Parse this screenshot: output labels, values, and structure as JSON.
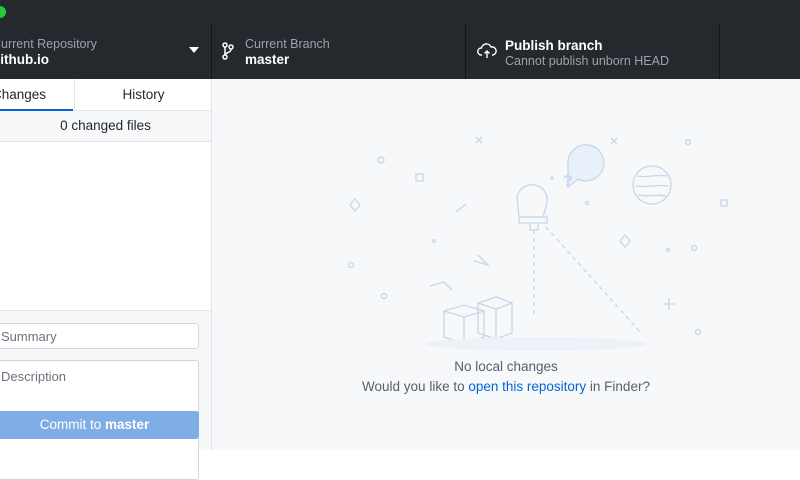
{
  "toolbar": {
    "repository": {
      "label": "Current Repository",
      "value": "github.io"
    },
    "branch": {
      "label": "Current Branch",
      "value": "master"
    },
    "publish": {
      "label": "Publish branch",
      "detail": "Cannot publish unborn HEAD"
    }
  },
  "sidebar": {
    "tabs": [
      {
        "label": "Changes"
      },
      {
        "label": "History"
      }
    ],
    "changed_files": "0 changed files",
    "summary_placeholder": "Summary",
    "description_placeholder": "Description",
    "commit_button": {
      "prefix": "Commit to ",
      "branch": "master"
    }
  },
  "main": {
    "empty_title": "No local changes",
    "empty_prefix": "Would you like to ",
    "empty_link": "open this repository",
    "empty_suffix": " in Finder?"
  },
  "icons": {
    "branch": "git-branch-icon",
    "publish": "cloud-upload-icon",
    "dropdown": "triangle-down-icon"
  },
  "colors": {
    "accent": "#0366d6",
    "toolbar_bg": "#24292e",
    "commit_button": "#7faee6"
  }
}
